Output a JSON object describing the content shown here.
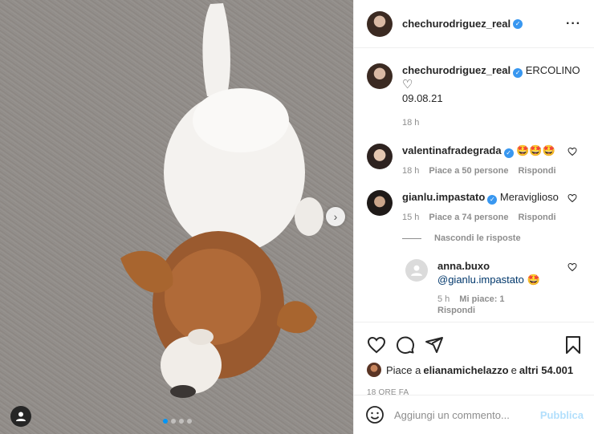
{
  "post": {
    "author": "chechurodriguez_real",
    "caption": "ERCOLINO",
    "caption_heart": "♡",
    "caption_date": "09.08.21",
    "caption_age": "18 h"
  },
  "comments": [
    {
      "user": "valentinafradegrada",
      "text": "🤩🤩🤩",
      "age": "18 h",
      "likes": "Piace a 50 persone",
      "reply": "Rispondi"
    },
    {
      "user": "gianlu.impastato",
      "text": "Meraviglioso",
      "age": "15 h",
      "likes": "Piace a 74 persone",
      "reply": "Rispondi"
    }
  ],
  "hide_replies": "Nascondi le risposte",
  "replies": [
    {
      "user": "anna.buxo",
      "mention": "@gianlu.impastato",
      "emoji": "🤩",
      "age": "5 h",
      "likes": "Mi piace: 1",
      "reply": "Rispondi"
    }
  ],
  "liked_by": {
    "prefix": "Piace a ",
    "user": "elianamichelazzo",
    "mid": " e ",
    "others": "altri 54.001"
  },
  "timestamp": "18 ORE FA",
  "composer": {
    "placeholder": "Aggiungi un commento...",
    "publish": "Pubblica"
  },
  "carousel": {
    "slides": 4,
    "active": 1
  },
  "colors": {
    "accent": "#0095f6",
    "verified": "#3897f0",
    "publish_disabled": "#b2dffc"
  },
  "icons": [
    "verified-badge-icon",
    "more-options-icon",
    "heart-icon",
    "comment-icon",
    "share-icon",
    "bookmark-icon",
    "emoji-icon",
    "next-arrow-icon",
    "user-tag-icon"
  ]
}
